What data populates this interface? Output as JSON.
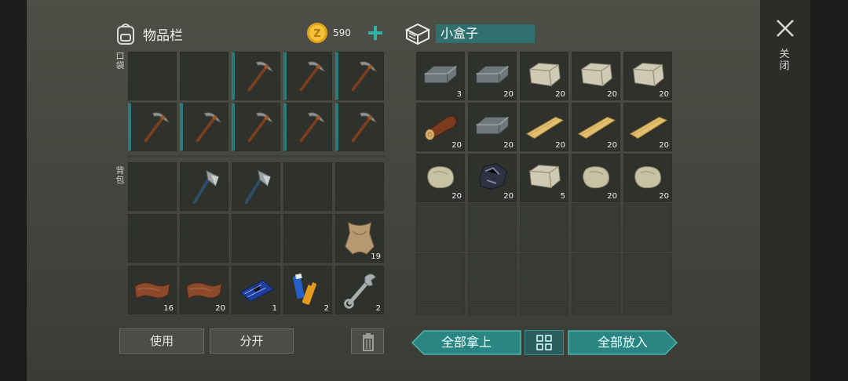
{
  "inventory": {
    "title": "物品栏",
    "coins": "590",
    "pocket_label": "口袋",
    "backpack_label": "背包",
    "pocket_slots": [
      {
        "item": "",
        "qty": "",
        "hot": false
      },
      {
        "item": "",
        "qty": "",
        "hot": false
      },
      {
        "item": "pickaxe",
        "qty": "",
        "hot": true
      },
      {
        "item": "pickaxe",
        "qty": "",
        "hot": true
      },
      {
        "item": "pickaxe",
        "qty": "",
        "hot": true
      },
      {
        "item": "pickaxe",
        "qty": "",
        "hot": true
      },
      {
        "item": "pickaxe",
        "qty": "",
        "hot": true
      },
      {
        "item": "pickaxe",
        "qty": "",
        "hot": true
      },
      {
        "item": "pickaxe",
        "qty": "",
        "hot": true
      },
      {
        "item": "pickaxe",
        "qty": "",
        "hot": true
      }
    ],
    "backpack_slots": [
      {
        "item": "",
        "qty": ""
      },
      {
        "item": "hatchet",
        "qty": ""
      },
      {
        "item": "hatchet",
        "qty": ""
      },
      {
        "item": "",
        "qty": ""
      },
      {
        "item": "",
        "qty": ""
      },
      {
        "item": "",
        "qty": ""
      },
      {
        "item": "",
        "qty": ""
      },
      {
        "item": "",
        "qty": ""
      },
      {
        "item": "",
        "qty": ""
      },
      {
        "item": "animal-hide",
        "qty": "19"
      },
      {
        "item": "leather",
        "qty": "16"
      },
      {
        "item": "leather",
        "qty": "20"
      },
      {
        "item": "circuit-board",
        "qty": "1"
      },
      {
        "item": "batteries",
        "qty": "2"
      },
      {
        "item": "wrench",
        "qty": "2"
      }
    ],
    "use_label": "使用",
    "split_label": "分开"
  },
  "container": {
    "name": "小盒子",
    "slots": [
      {
        "item": "iron-ingot",
        "qty": "3"
      },
      {
        "item": "iron-ingot",
        "qty": "20"
      },
      {
        "item": "stone-block",
        "qty": "20"
      },
      {
        "item": "stone-block",
        "qty": "20"
      },
      {
        "item": "stone-block",
        "qty": "20"
      },
      {
        "item": "log",
        "qty": "20"
      },
      {
        "item": "iron-ingot",
        "qty": "20"
      },
      {
        "item": "plank",
        "qty": "20"
      },
      {
        "item": "plank",
        "qty": "20"
      },
      {
        "item": "plank",
        "qty": "20"
      },
      {
        "item": "stone",
        "qty": "20"
      },
      {
        "item": "iron-ore",
        "qty": "20"
      },
      {
        "item": "stone-block",
        "qty": "5"
      },
      {
        "item": "stone",
        "qty": "20"
      },
      {
        "item": "stone",
        "qty": "20"
      }
    ],
    "take_all_label": "全部拿上",
    "put_all_label": "全部放入"
  },
  "close_label": "关闭",
  "colors": {
    "accent": "#2f8f8c",
    "slot": "#2f312c"
  }
}
